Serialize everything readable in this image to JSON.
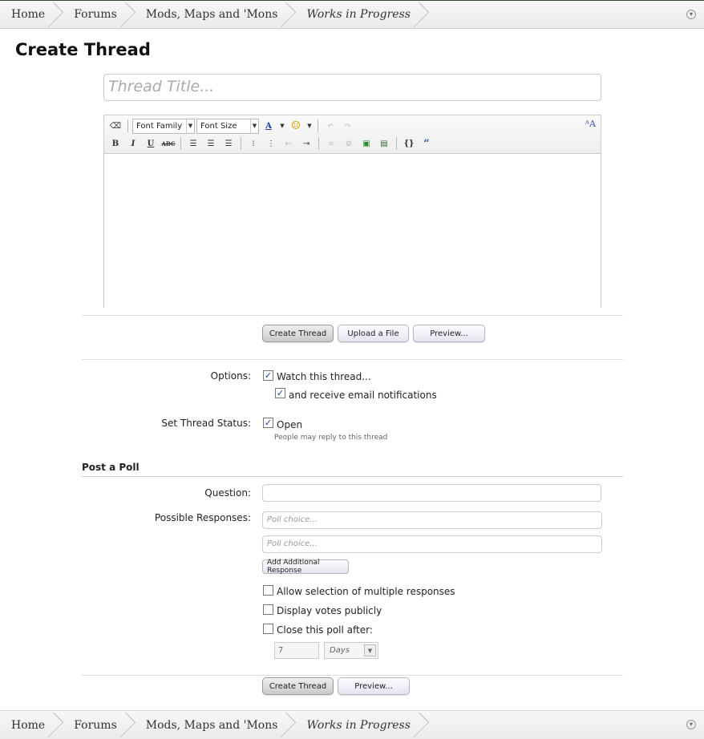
{
  "breadcrumb": {
    "items": [
      "Home",
      "Forums",
      "Mods, Maps and 'Mons",
      "Works in Progress"
    ],
    "jump_icon": "chevron-down-circle-icon"
  },
  "page": {
    "title": "Create Thread"
  },
  "thread_title": {
    "placeholder": "Thread Title..."
  },
  "editor": {
    "font_family": "Font Family",
    "font_size": "Font Size",
    "bold": "B",
    "italic": "I",
    "underline": "U",
    "strike": "ABC"
  },
  "actions": {
    "create": "Create Thread",
    "upload": "Upload a File",
    "preview": "Preview..."
  },
  "options": {
    "label": "Options:",
    "watch": "Watch this thread...",
    "email": "and receive email notifications",
    "status_label": "Set Thread Status:",
    "open": "Open",
    "open_hint": "People may reply to this thread"
  },
  "poll": {
    "heading": "Post a Poll",
    "question_label": "Question:",
    "responses_label": "Possible Responses:",
    "choice_placeholder": "Poll choice...",
    "add_response": "Add Additional Response",
    "multiple": "Allow selection of multiple responses",
    "public": "Display votes publicly",
    "close_after": "Close this poll after:",
    "close_value": "7",
    "close_unit": "Days"
  },
  "colors": {
    "accent": "#1c3fa0",
    "bar_border": "#2f4a2a"
  }
}
